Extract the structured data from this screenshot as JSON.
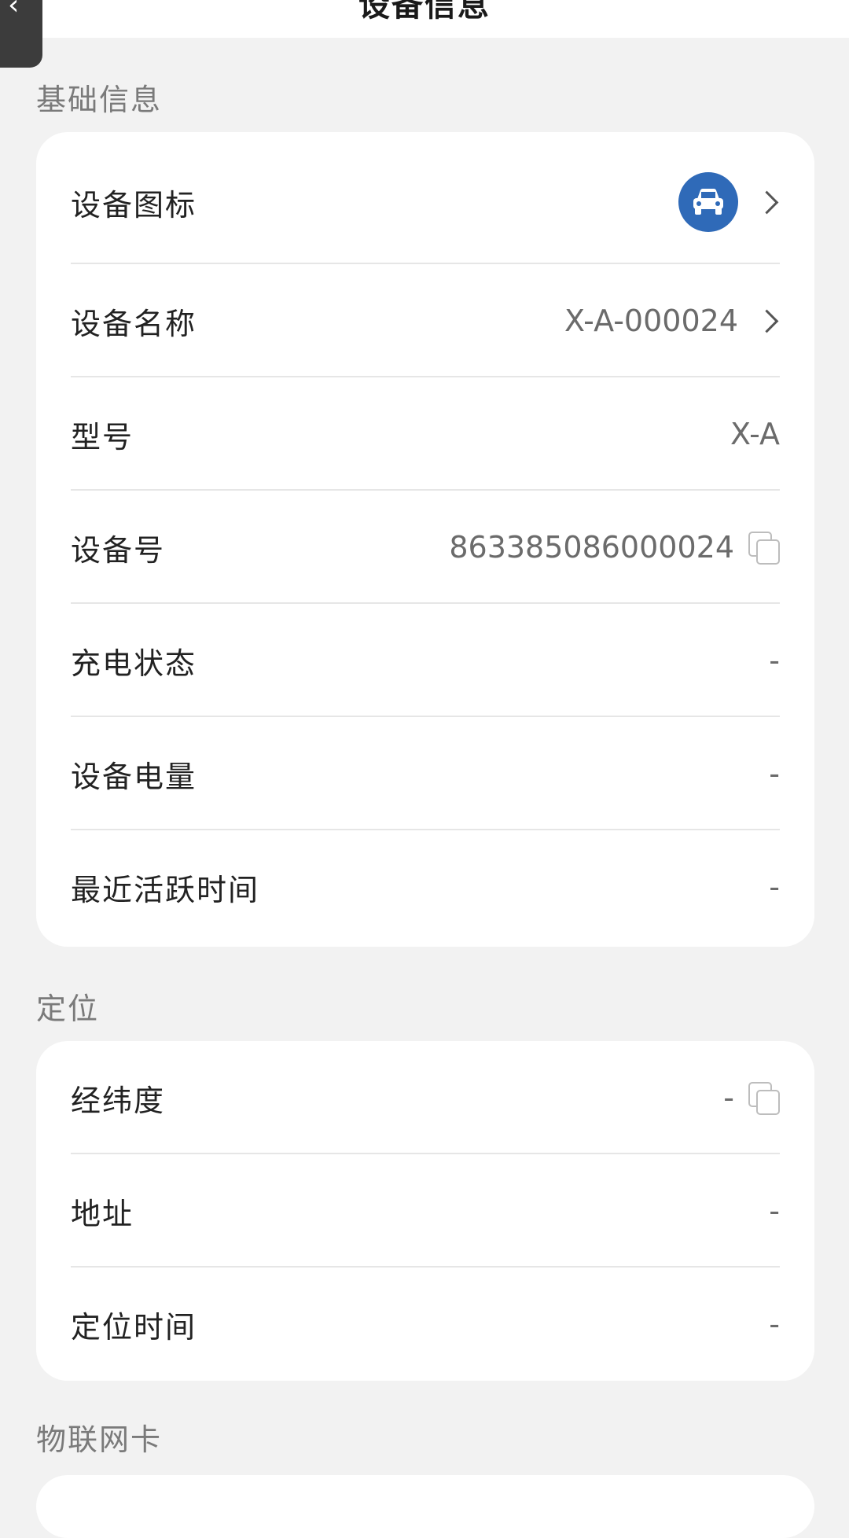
{
  "header": {
    "title": "设备信息"
  },
  "sections": {
    "basic": {
      "title": "基础信息",
      "rows": [
        {
          "label": "设备图标"
        },
        {
          "label": "设备名称",
          "value": "X-A-000024"
        },
        {
          "label": "型号",
          "value": "X-A"
        },
        {
          "label": "设备号",
          "value": "863385086000024"
        },
        {
          "label": "充电状态",
          "value": "-"
        },
        {
          "label": "设备电量",
          "value": "-"
        },
        {
          "label": "最近活跃时间",
          "value": "-"
        }
      ]
    },
    "location": {
      "title": "定位",
      "rows": [
        {
          "label": "经纬度",
          "value": "-"
        },
        {
          "label": "地址",
          "value": "-"
        },
        {
          "label": "定位时间",
          "value": "-"
        }
      ]
    },
    "iot": {
      "title": "物联网卡"
    }
  },
  "icons": {
    "device": "car-icon",
    "copy": "copy-icon",
    "chevron": "chevron-right-icon",
    "back": "back-icon"
  },
  "colors": {
    "accent": "#2f6ab8",
    "background": "#f2f2f2",
    "card": "#ffffff"
  }
}
